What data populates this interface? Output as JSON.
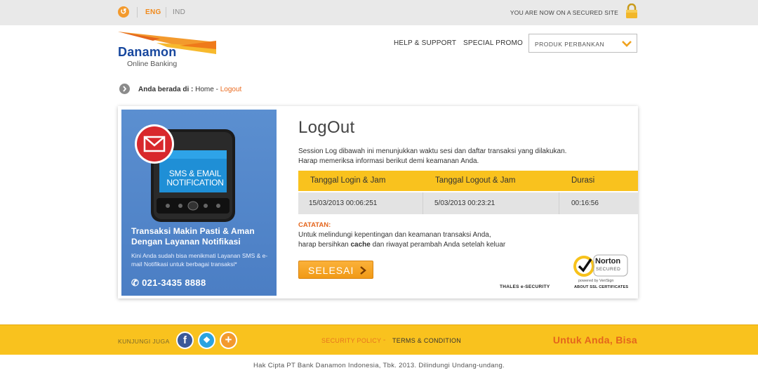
{
  "topbar": {
    "lang_active": "ENG",
    "lang_inactive": "IND",
    "secured_text": "YOU ARE NOW ON A SECURED SITE"
  },
  "header": {
    "logo_name": "Danamon",
    "logo_sub": "Online Banking",
    "nav": [
      "HELP & SUPPORT",
      "SPECIAL PROMO"
    ],
    "dropdown_value": "PRODUK PERBANKAN"
  },
  "breadcrumb": {
    "prefix": "Anda berada di :",
    "home": "Home",
    "separator": "-",
    "current": "Logout"
  },
  "banner": {
    "sms_line1": "SMS & EMAIL",
    "sms_line2": "NOTIFICATION",
    "headline": "Transaksi Makin Pasti & Aman Dengan Layanan Notifikasi",
    "body": "Kini Anda sudah bisa menikmati Layanan SMS & e-mail Notifikasi untuk berbagai transaksi*",
    "phone": "021-3435 8888"
  },
  "main": {
    "title": "LogOut",
    "intro_line1": "Session Log dibawah ini menunjukkan waktu sesi dan daftar transaksi yang dilakukan.",
    "intro_line2": "Harap memeriksa informasi berikut demi keamanan Anda.",
    "table": {
      "headers": [
        "Tanggal Login & Jam",
        "Tanggal Logout & Jam",
        "Durasi"
      ],
      "row": [
        "15/03/2013 00:06:251",
        "5/03/2013 00:23:21",
        "00:16:56"
      ]
    },
    "note_heading": "CATATAN:",
    "note_line1": "Untuk melindungi kepentingan dan keamanan transaksi Anda,",
    "note_line2_a": "harap bersihkan",
    "note_line2_b": "cache",
    "note_line2_c": "dan riwayat perambah Anda setelah keluar",
    "button_label": "SELESAI",
    "thales": "THALES e-SECURITY",
    "norton": {
      "name": "Norton",
      "secured": "SECURED",
      "powered": "powered by VeriSign",
      "about": "ABOUT SSL CERTIFICATES"
    }
  },
  "footer": {
    "visit_label": "KUNJUNGI JUGA",
    "social_icons": [
      "facebook-icon",
      "twitter-icon",
      "plus-icon"
    ],
    "links": [
      "SECURITY POLICY",
      "TERMS & CONDITION"
    ],
    "separator": "-",
    "slogan": "Untuk Anda, Bisa"
  },
  "copyright": "Hak Cipta PT Bank Danamon Indonesia, Tbk. 2013. Dilindungi Undang-undang.",
  "colors": {
    "accent_orange": "#f39a2d",
    "brand_yellow": "#f9c21e",
    "brand_blue": "#17479e"
  }
}
